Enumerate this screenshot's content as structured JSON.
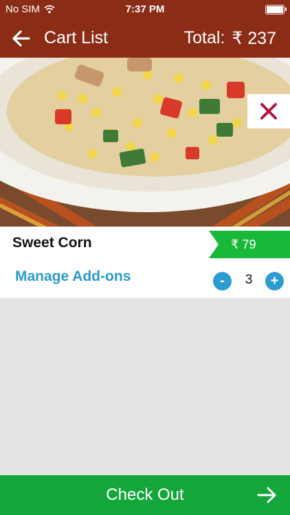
{
  "status": {
    "carrier": "No SIM",
    "time": "7:37 PM",
    "battery_level": 1.0
  },
  "nav": {
    "title": "Cart List",
    "total_label": "Total:",
    "total_value": "₹ 237"
  },
  "cart": {
    "items": [
      {
        "name": "Sweet Corn",
        "price": "₹ 79",
        "addons_label": "Manage Add-ons",
        "quantity": "3",
        "minus_symbol": "-",
        "plus_symbol": "+"
      }
    ]
  },
  "checkout": {
    "label": "Check Out"
  },
  "colors": {
    "primary": "#8b2c16",
    "checkout": "#14a63b",
    "price_tag": "#18b83a",
    "accent": "#2b9bd0",
    "remove": "#b3153c",
    "background": "#e3e3e3"
  }
}
